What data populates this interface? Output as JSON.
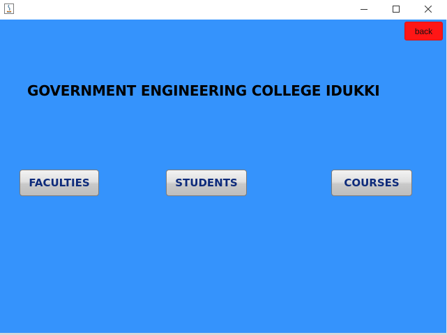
{
  "window": {
    "controls": {
      "minimize_icon": "minimize-icon",
      "maximize_icon": "maximize-icon",
      "close_icon": "close-icon"
    }
  },
  "toolbar": {
    "back_label": "back"
  },
  "main": {
    "title": "GOVERNMENT ENGINEERING COLLEGE IDUKKI",
    "buttons": {
      "faculties": "FACULTIES",
      "students": "STUDENTS",
      "courses": "COURSES"
    }
  },
  "colors": {
    "background": "#3593fc",
    "back_button": "#ff1616",
    "button_text": "#0d2a7a"
  }
}
